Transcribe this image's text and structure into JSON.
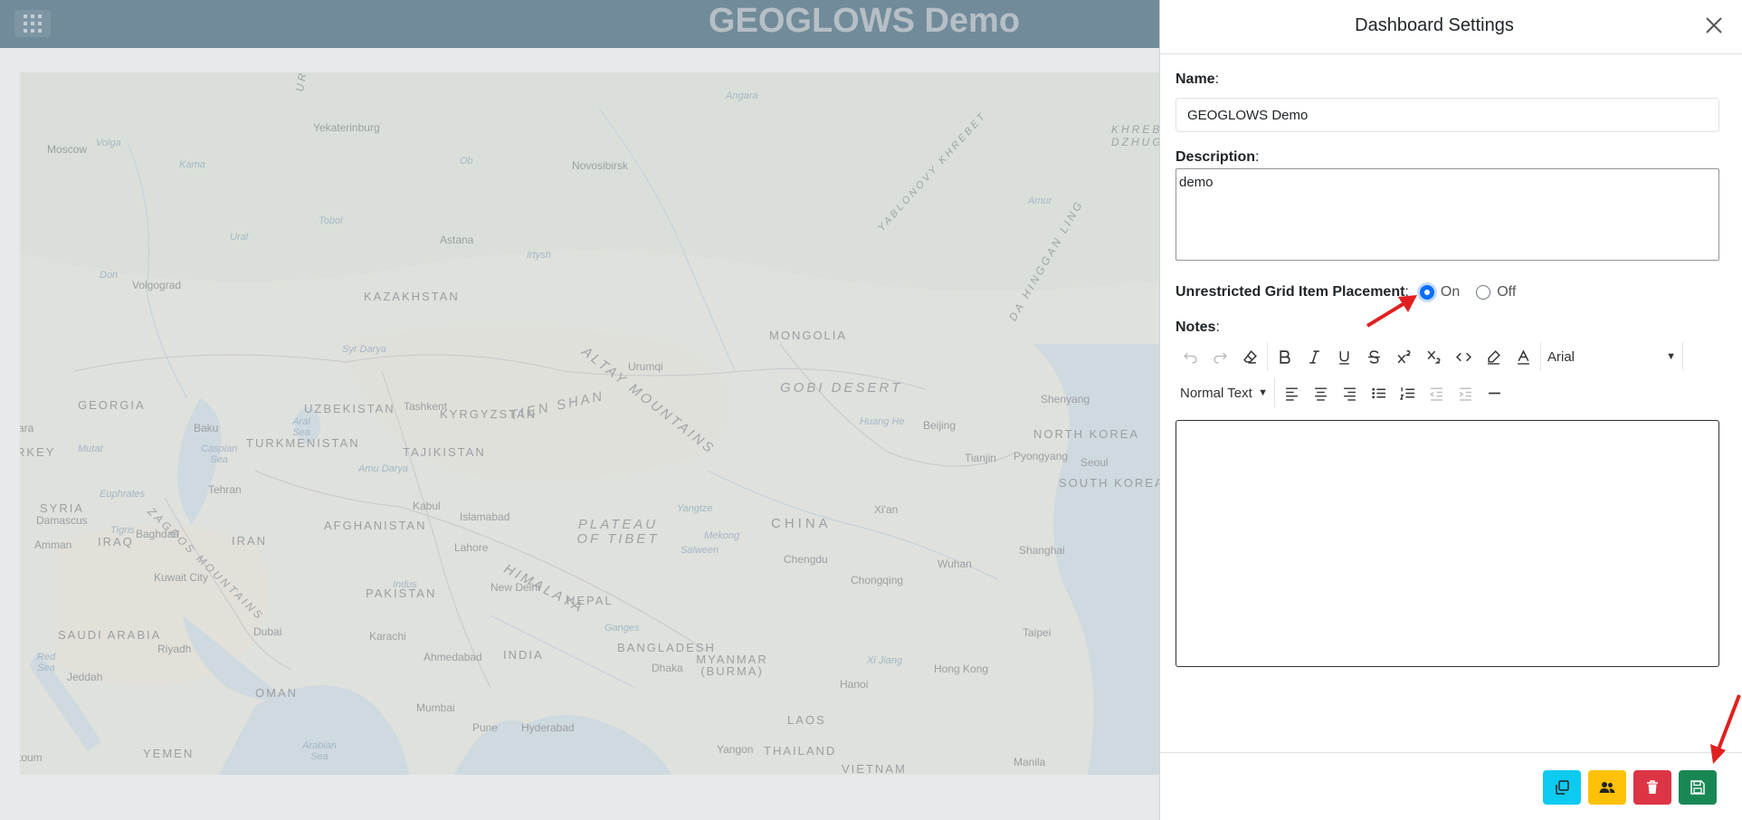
{
  "header": {
    "title": "GEOGLOWS Demo",
    "apps_icon": "grid-icon"
  },
  "map": {
    "labels": {
      "countries": [
        "KAZAKHSTAN",
        "MONGOLIA",
        "CHINA",
        "INDIA",
        "PAKISTAN",
        "IRAN",
        "AFGHANISTAN",
        "UZBEKISTAN",
        "TURKMENISTAN",
        "TAJIKISTAN",
        "KYRGYZSTAN",
        "GEORGIA",
        "IRAQ",
        "SYRIA",
        "SAUDI ARABIA",
        "OMAN",
        "YEMEN",
        "NEPAL",
        "BANGLADESH",
        "MYANMAR (BURMA)",
        "LAOS",
        "THAILAND",
        "VIETNAM",
        "NORTH KOREA",
        "SOUTH KOREA",
        "RKEY"
      ],
      "cities": [
        "Moscow",
        "Yekaterinburg",
        "Novosibirsk",
        "Astana",
        "Volgograd",
        "Urumqi",
        "Tashkent",
        "Baku",
        "Tehran",
        "Kabul",
        "Islamabad",
        "Lahore",
        "New Delhi",
        "Baghdad",
        "Damascus",
        "Amman",
        "Kuwait City",
        "Riyadh",
        "Jeddah",
        "Dubai",
        "Karachi",
        "Ahmedabad",
        "Mumbai",
        "Pune",
        "Hyderabad",
        "Dhaka",
        "Yangon",
        "Hanoi",
        "Chengdu",
        "Chongqing",
        "Wuhan",
        "Shanghai",
        "Beijing",
        "Tianjin",
        "Pyongyang",
        "Seoul",
        "Shenyang",
        "Xi'an",
        "Hong Kong",
        "Taipei",
        "Manila",
        "ara",
        "toum"
      ],
      "regions": [
        "ALTAY MOUNTAINS",
        "GOBI DESERT",
        "TIEN SHAN",
        "PLATEAU OF TIBET",
        "HIMALAYA",
        "ZAGROS MOUNTAINS",
        "YABLONOVY KHREBET",
        "DA HINGGAN LING",
        "URA",
        "KHREB DZHUGD"
      ],
      "water": [
        "Caspian Sea",
        "Aral Sea",
        "Red Sea",
        "Arabian Sea",
        "Volga",
        "Kama",
        "Ural",
        "Tobol",
        "Irtysh",
        "Ob",
        "Angara",
        "Amur",
        "Huang He",
        "Yangtze",
        "Mekong",
        "Salween",
        "Ganges",
        "Indus",
        "Euphrates",
        "Tigris",
        "Syr Darya",
        "Amu Darya",
        "Xi Jiang",
        "Don",
        "Mutat"
      ]
    }
  },
  "panel": {
    "title": "Dashboard Settings",
    "close_icon": "close-icon",
    "name_label": "Name",
    "name_value": "GEOGLOWS Demo",
    "description_label": "Description",
    "description_value": "demo",
    "placement_label": "Unrestricted Grid Item Placement",
    "placement_on": "On",
    "placement_off": "Off",
    "placement_selected": "On",
    "notes_label": "Notes",
    "colon": ":",
    "toolbar": {
      "font_family": "Arial",
      "block_type": "Normal Text",
      "row1_icons": [
        "undo-icon",
        "redo-icon",
        "eraser-icon",
        "bold-icon",
        "italic-icon",
        "underline-icon",
        "strikethrough-icon",
        "superscript-icon",
        "subscript-icon",
        "code-icon",
        "highlight-icon",
        "text-color-icon"
      ],
      "row2_icons": [
        "align-left-icon",
        "align-center-icon",
        "align-right-icon",
        "bullet-list-icon",
        "numbered-list-icon",
        "outdent-icon",
        "indent-icon",
        "horizontal-rule-icon"
      ]
    },
    "footer": {
      "buttons": [
        {
          "name": "copy-button",
          "icon": "copy-icon",
          "color": "#0dcaf0"
        },
        {
          "name": "share-button",
          "icon": "users-icon",
          "color": "#ffc107"
        },
        {
          "name": "delete-button",
          "icon": "trash-icon",
          "color": "#dc3545"
        },
        {
          "name": "save-button",
          "icon": "save-icon",
          "color": "#198754"
        }
      ]
    }
  },
  "colors": {
    "header_bg": "#0d3b54",
    "radio_checked": "#0d6efd",
    "annotation_arrow": "#e02020"
  }
}
